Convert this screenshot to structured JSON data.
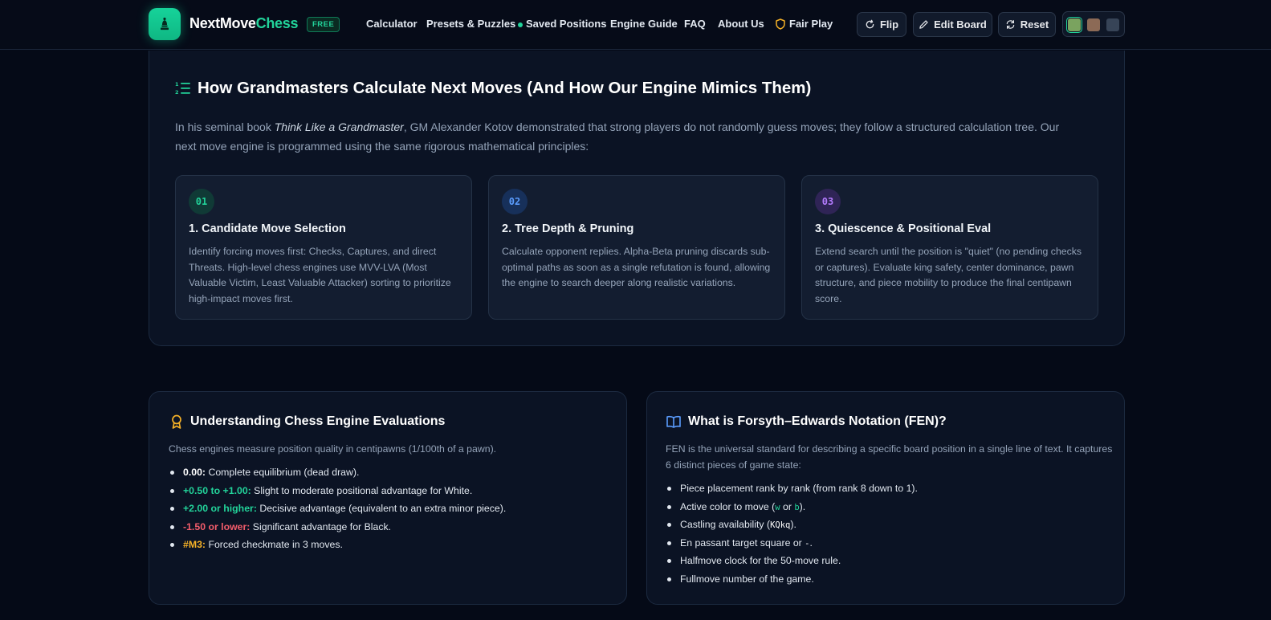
{
  "header": {
    "brand_part1": "NextMove",
    "brand_part2": "Chess",
    "badge": "FREE",
    "nav": {
      "calculator": "Calculator",
      "presets": "Presets & Puzzles",
      "saved": "Saved Positions",
      "engine_guide": "Engine Guide",
      "faq": "FAQ",
      "about": "About Us",
      "fair_play": "Fair Play"
    },
    "buttons": {
      "flip": "Flip",
      "edit_board": "Edit Board",
      "reset": "Reset"
    },
    "board_themes": [
      "#7aa35f",
      "#8c6a56",
      "#374457"
    ],
    "accent": "#22d39a"
  },
  "grandmasters": {
    "title": "How Grandmasters Calculate Next Moves (And How Our Engine Mimics Them)",
    "intro_before": "In his seminal book ",
    "intro_book": "Think Like a Grandmaster",
    "intro_after": ", GM Alexander Kotov demonstrated that strong players do not randomly guess moves; they follow a structured calculation tree. Our next move engine is programmed using the same rigorous mathematical principles:",
    "steps": [
      {
        "num": "01",
        "title": "1. Candidate Move Selection",
        "body": "Identify forcing moves first: Checks, Captures, and direct Threats. High-level chess engines use MVV-LVA (Most Valuable Victim, Least Valuable Attacker) sorting to prioritize high-impact moves first.",
        "color": "#22d39a",
        "bg": "#103a36"
      },
      {
        "num": "02",
        "title": "2. Tree Depth & Pruning",
        "body": "Calculate opponent replies. Alpha-Beta pruning discards sub-optimal paths as soon as a single refutation is found, allowing the engine to search deeper along realistic variations.",
        "color": "#5b9dff",
        "bg": "#17305a"
      },
      {
        "num": "03",
        "title": "3. Quiescence & Positional Eval",
        "body": "Extend search until the position is \"quiet\" (no pending checks or captures). Evaluate king safety, center dominance, pawn structure, and piece mobility to produce the final centipawn score.",
        "color": "#b57cff",
        "bg": "#2f2456"
      }
    ]
  },
  "evaluations": {
    "title": "Understanding Chess Engine Evaluations",
    "intro": "Chess engines measure position quality in centipawns (1/100th of a pawn).",
    "items": [
      {
        "key": "0.00:",
        "text": " Complete equilibrium (dead draw)."
      },
      {
        "key": "+0.50 to +1.00:",
        "text": " Slight to moderate positional advantage for White."
      },
      {
        "key": "+2.00 or higher:",
        "text": " Decisive advantage (equivalent to an extra minor piece)."
      },
      {
        "key": "-1.50 or lower:",
        "text": " Significant advantage for Black."
      },
      {
        "key": "#M3:",
        "text": " Forced checkmate in 3 moves."
      }
    ]
  },
  "fen": {
    "title": "What is Forsyth–Edwards Notation (FEN)?",
    "intro": "FEN is the universal standard for describing a specific board position in a single line of text. It captures 6 distinct pieces of game state:",
    "item1": "Piece placement rank by rank (from rank 8 down to 1).",
    "item2_before": "Active color to move (",
    "item2_w": "w",
    "item2_or": " or ",
    "item2_b": "b",
    "item2_after": ").",
    "item3_before": "Castling availability (",
    "item3_code": "KQkq",
    "item3_after": ").",
    "item4_before": "En passant target square or ",
    "item4_code": "-",
    "item4_after": ".",
    "item5": "Halfmove clock for the 50-move rule.",
    "item6": "Fullmove number of the game."
  }
}
